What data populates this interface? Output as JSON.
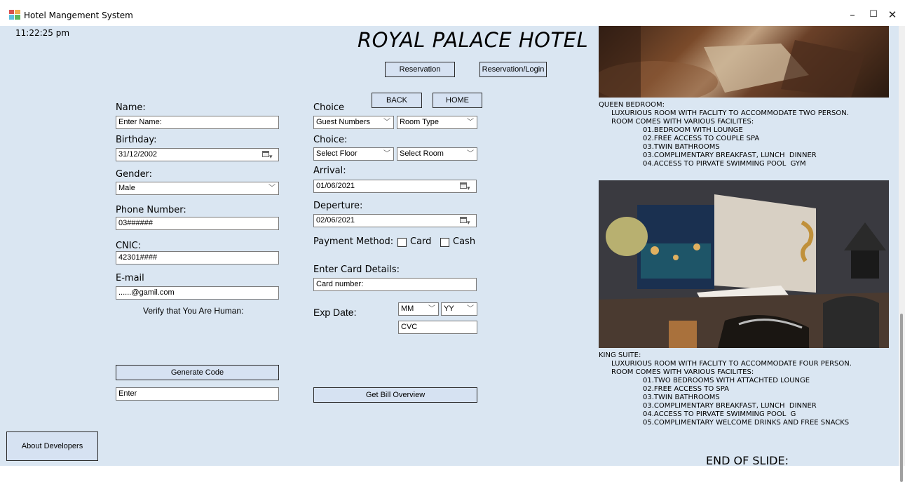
{
  "window": {
    "title": "Hotel Mangement System",
    "controls": {
      "minimize": "–",
      "maximize": "☐",
      "close": "✕"
    }
  },
  "clock": "11:22:25 pm",
  "hotel_title": "ROYAL PALACE HOTEL",
  "top_buttons": {
    "reservation": "Reservation",
    "reservation_login": "Reservation/Login",
    "back": "BACK",
    "home": "HOME"
  },
  "left_form": {
    "name_label": "Name:",
    "name_value": "Enter Name:",
    "birthday_label": "Birthday:",
    "birthday_value": "31/12/2002",
    "gender_label": "Gender:",
    "gender_value": "Male",
    "phone_label": "Phone Number:",
    "phone_value": "03######",
    "cnic_label": "CNIC:",
    "cnic_value": "42301####",
    "email_label": "E-mail",
    "email_value": "......@gamil.com",
    "verify_text": "Verify that You Are Human:",
    "generate_code": "Generate Code",
    "enter_value": "Enter"
  },
  "mid_form": {
    "choice1_label": "Choice",
    "guest_numbers": "Guest Numbers",
    "room_type": "Room Type",
    "choice2_label": "Choice:",
    "select_floor": "Select Floor",
    "select_room": "Select Room",
    "arrival_label": "Arrival:",
    "arrival_value": "01/06/2021",
    "departure_label": "Deperture:",
    "departure_value": "02/06/2021",
    "payment_label": "Payment Method:",
    "card": "Card",
    "cash": "Cash",
    "card_details_label": "Enter Card Details:",
    "card_number": "Card number:",
    "exp_label": "Exp Date:",
    "mm": "MM",
    "yy": "YY",
    "cvc": "CVC",
    "bill_button": "Get Bill Overview"
  },
  "about_button": "About Developers",
  "queen": {
    "title": "QUEEN BEDROOM:",
    "line1": "LUXURIOUS ROOM WITH FACLITY TO ACCOMMODATE TWO PERSON.",
    "line2": "ROOM COMES WITH VARIOUS FACILITES:",
    "items": [
      "01.BEDROOM WITH LOUNGE",
      "02.FREE ACCESS TO COUPLE SPA",
      "03.TWIN BATHROOMS",
      "03.COMPLIMENTARY BREAKFAST, LUNCH  DINNER",
      "04.ACCESS TO PIRVATE SWIMMING POOL  GYM"
    ]
  },
  "king": {
    "title": "KING SUITE:",
    "line1": "LUXURIOUS ROOM WITH FACLITY TO ACCOMMODATE FOUR PERSON.",
    "line2": "ROOM COMES WITH VARIOUS FACILITES:",
    "items": [
      "01.TWO BEDROOMS WITH ATTACHTED LOUNGE",
      "02.FREE ACCESS TO SPA",
      "03.TWIN BATHROOMS",
      "03.COMPLIMENTARY BREAKFAST, LUNCH  DINNER",
      "04.ACCESS TO PIRVATE SWIMMING POOL  G",
      "05.COMPLIMENTARY WELCOME DRINKS AND FREE SNACKS"
    ]
  },
  "end_text": "END OF SLIDE:"
}
